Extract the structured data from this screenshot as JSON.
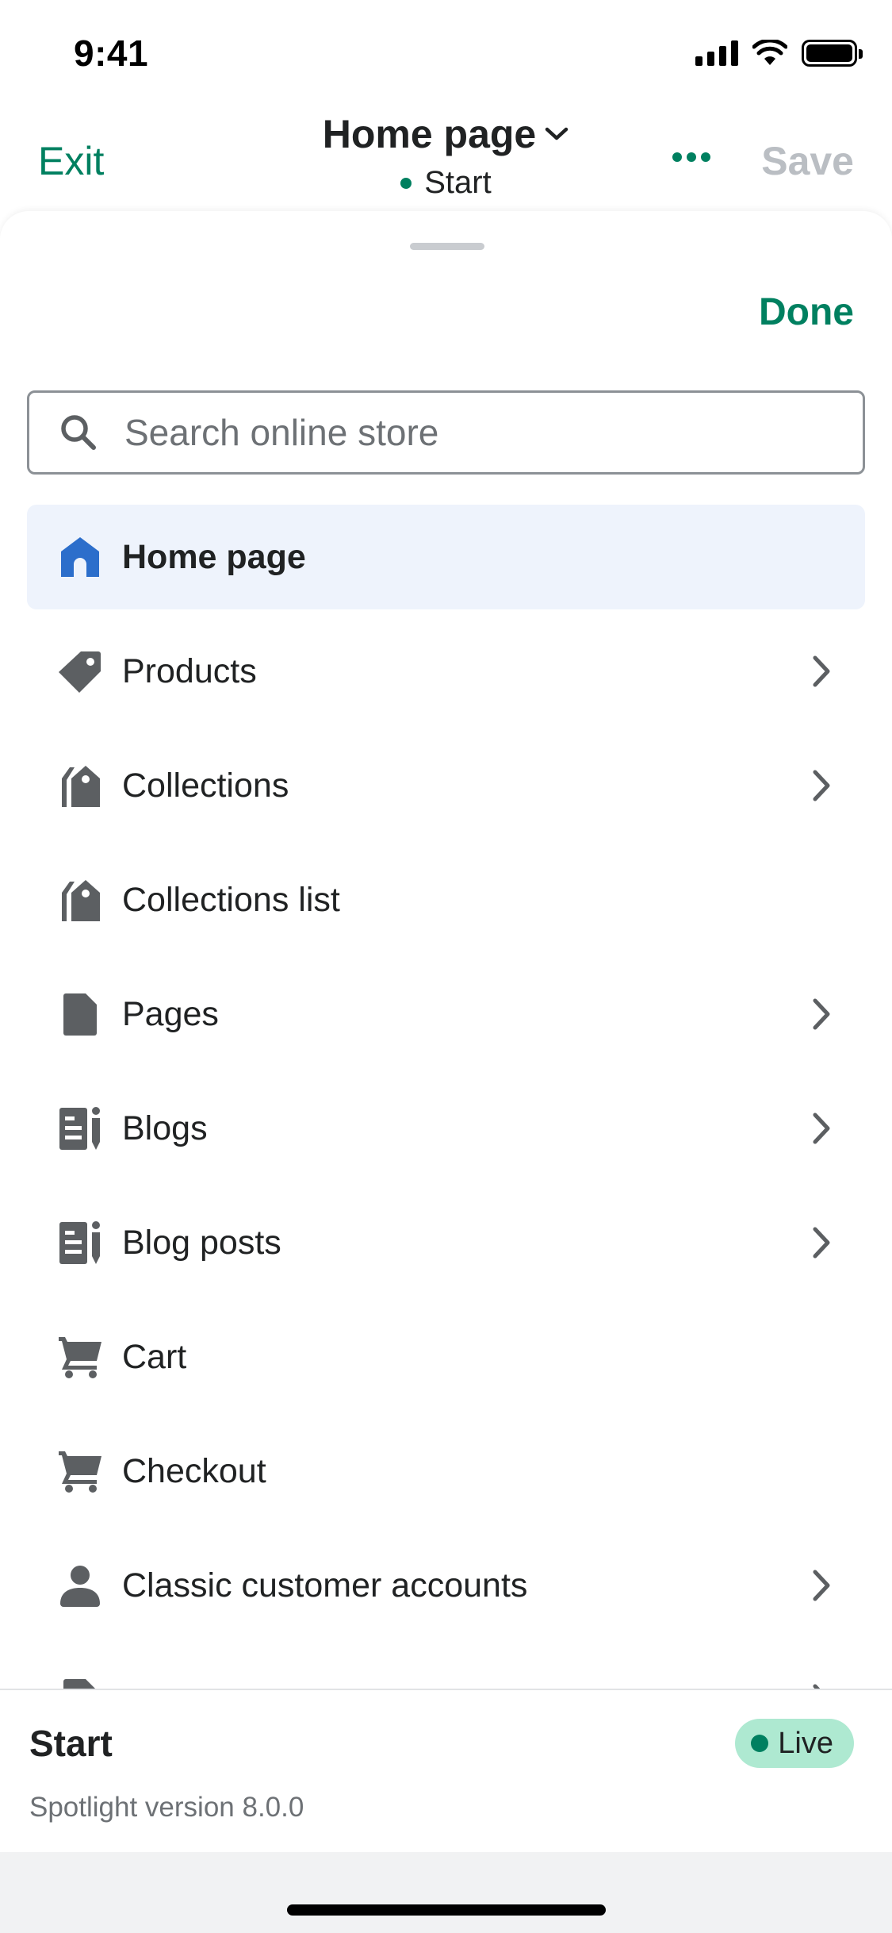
{
  "status_bar": {
    "time": "9:41"
  },
  "header": {
    "exit_label": "Exit",
    "title": "Home page",
    "subtitle": "Start",
    "save_label": "Save"
  },
  "sheet": {
    "done_label": "Done",
    "search": {
      "placeholder": "Search online store"
    },
    "items": [
      {
        "label": "Home page",
        "icon": "home-icon",
        "selected": true,
        "chevron": false
      },
      {
        "label": "Products",
        "icon": "tag-icon",
        "chevron": true
      },
      {
        "label": "Collections",
        "icon": "collection-icon",
        "chevron": true
      },
      {
        "label": "Collections list",
        "icon": "collection-icon",
        "chevron": false
      },
      {
        "label": "Pages",
        "icon": "page-icon",
        "chevron": true
      },
      {
        "label": "Blogs",
        "icon": "blog-icon",
        "chevron": true
      },
      {
        "label": "Blog posts",
        "icon": "blog-icon",
        "chevron": true
      },
      {
        "label": "Cart",
        "icon": "cart-icon",
        "chevron": false
      },
      {
        "label": "Checkout",
        "icon": "cart-icon",
        "chevron": false
      },
      {
        "label": "Classic customer accounts",
        "icon": "customer-icon",
        "chevron": true
      }
    ]
  },
  "footer": {
    "title": "Start",
    "status_badge": "Live",
    "version": "Spotlight version 8.0.0"
  },
  "colors": {
    "accent": "#008060",
    "selected_background": "#eef3fc",
    "selected_icon": "#2c6ecb",
    "icon_gray": "#5c5f62",
    "live_badge": "#aee9d1"
  }
}
